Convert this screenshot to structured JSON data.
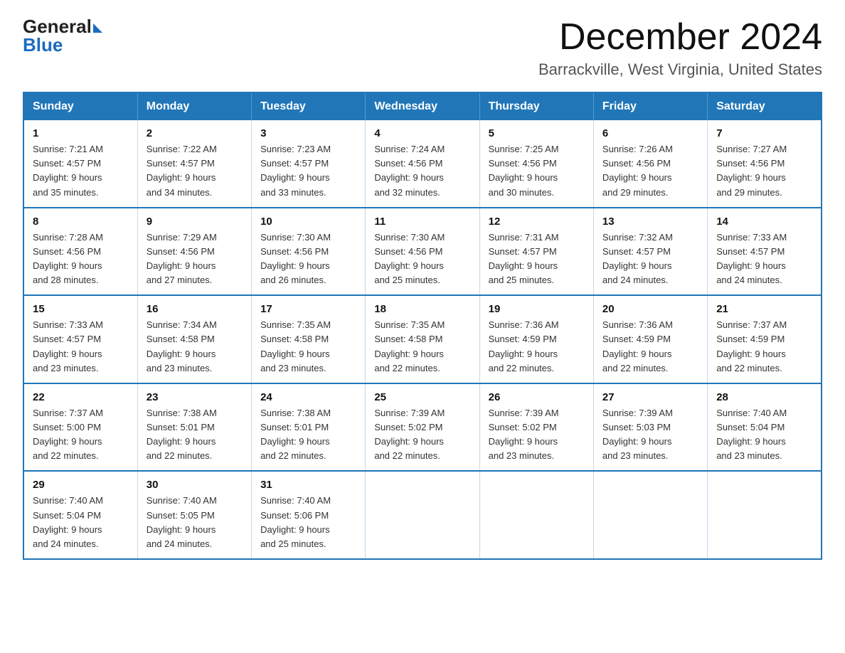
{
  "header": {
    "logo_general": "General",
    "logo_blue": "Blue",
    "title": "December 2024",
    "location": "Barrackville, West Virginia, United States"
  },
  "days_of_week": [
    "Sunday",
    "Monday",
    "Tuesday",
    "Wednesday",
    "Thursday",
    "Friday",
    "Saturday"
  ],
  "weeks": [
    [
      {
        "day": "1",
        "sunrise": "7:21 AM",
        "sunset": "4:57 PM",
        "daylight": "9 hours and 35 minutes."
      },
      {
        "day": "2",
        "sunrise": "7:22 AM",
        "sunset": "4:57 PM",
        "daylight": "9 hours and 34 minutes."
      },
      {
        "day": "3",
        "sunrise": "7:23 AM",
        "sunset": "4:57 PM",
        "daylight": "9 hours and 33 minutes."
      },
      {
        "day": "4",
        "sunrise": "7:24 AM",
        "sunset": "4:56 PM",
        "daylight": "9 hours and 32 minutes."
      },
      {
        "day": "5",
        "sunrise": "7:25 AM",
        "sunset": "4:56 PM",
        "daylight": "9 hours and 30 minutes."
      },
      {
        "day": "6",
        "sunrise": "7:26 AM",
        "sunset": "4:56 PM",
        "daylight": "9 hours and 29 minutes."
      },
      {
        "day": "7",
        "sunrise": "7:27 AM",
        "sunset": "4:56 PM",
        "daylight": "9 hours and 29 minutes."
      }
    ],
    [
      {
        "day": "8",
        "sunrise": "7:28 AM",
        "sunset": "4:56 PM",
        "daylight": "9 hours and 28 minutes."
      },
      {
        "day": "9",
        "sunrise": "7:29 AM",
        "sunset": "4:56 PM",
        "daylight": "9 hours and 27 minutes."
      },
      {
        "day": "10",
        "sunrise": "7:30 AM",
        "sunset": "4:56 PM",
        "daylight": "9 hours and 26 minutes."
      },
      {
        "day": "11",
        "sunrise": "7:30 AM",
        "sunset": "4:56 PM",
        "daylight": "9 hours and 25 minutes."
      },
      {
        "day": "12",
        "sunrise": "7:31 AM",
        "sunset": "4:57 PM",
        "daylight": "9 hours and 25 minutes."
      },
      {
        "day": "13",
        "sunrise": "7:32 AM",
        "sunset": "4:57 PM",
        "daylight": "9 hours and 24 minutes."
      },
      {
        "day": "14",
        "sunrise": "7:33 AM",
        "sunset": "4:57 PM",
        "daylight": "9 hours and 24 minutes."
      }
    ],
    [
      {
        "day": "15",
        "sunrise": "7:33 AM",
        "sunset": "4:57 PM",
        "daylight": "9 hours and 23 minutes."
      },
      {
        "day": "16",
        "sunrise": "7:34 AM",
        "sunset": "4:58 PM",
        "daylight": "9 hours and 23 minutes."
      },
      {
        "day": "17",
        "sunrise": "7:35 AM",
        "sunset": "4:58 PM",
        "daylight": "9 hours and 23 minutes."
      },
      {
        "day": "18",
        "sunrise": "7:35 AM",
        "sunset": "4:58 PM",
        "daylight": "9 hours and 22 minutes."
      },
      {
        "day": "19",
        "sunrise": "7:36 AM",
        "sunset": "4:59 PM",
        "daylight": "9 hours and 22 minutes."
      },
      {
        "day": "20",
        "sunrise": "7:36 AM",
        "sunset": "4:59 PM",
        "daylight": "9 hours and 22 minutes."
      },
      {
        "day": "21",
        "sunrise": "7:37 AM",
        "sunset": "4:59 PM",
        "daylight": "9 hours and 22 minutes."
      }
    ],
    [
      {
        "day": "22",
        "sunrise": "7:37 AM",
        "sunset": "5:00 PM",
        "daylight": "9 hours and 22 minutes."
      },
      {
        "day": "23",
        "sunrise": "7:38 AM",
        "sunset": "5:01 PM",
        "daylight": "9 hours and 22 minutes."
      },
      {
        "day": "24",
        "sunrise": "7:38 AM",
        "sunset": "5:01 PM",
        "daylight": "9 hours and 22 minutes."
      },
      {
        "day": "25",
        "sunrise": "7:39 AM",
        "sunset": "5:02 PM",
        "daylight": "9 hours and 22 minutes."
      },
      {
        "day": "26",
        "sunrise": "7:39 AM",
        "sunset": "5:02 PM",
        "daylight": "9 hours and 23 minutes."
      },
      {
        "day": "27",
        "sunrise": "7:39 AM",
        "sunset": "5:03 PM",
        "daylight": "9 hours and 23 minutes."
      },
      {
        "day": "28",
        "sunrise": "7:40 AM",
        "sunset": "5:04 PM",
        "daylight": "9 hours and 23 minutes."
      }
    ],
    [
      {
        "day": "29",
        "sunrise": "7:40 AM",
        "sunset": "5:04 PM",
        "daylight": "9 hours and 24 minutes."
      },
      {
        "day": "30",
        "sunrise": "7:40 AM",
        "sunset": "5:05 PM",
        "daylight": "9 hours and 24 minutes."
      },
      {
        "day": "31",
        "sunrise": "7:40 AM",
        "sunset": "5:06 PM",
        "daylight": "9 hours and 25 minutes."
      },
      null,
      null,
      null,
      null
    ]
  ],
  "cell_labels": {
    "sunrise": "Sunrise:",
    "sunset": "Sunset:",
    "daylight": "Daylight:"
  }
}
